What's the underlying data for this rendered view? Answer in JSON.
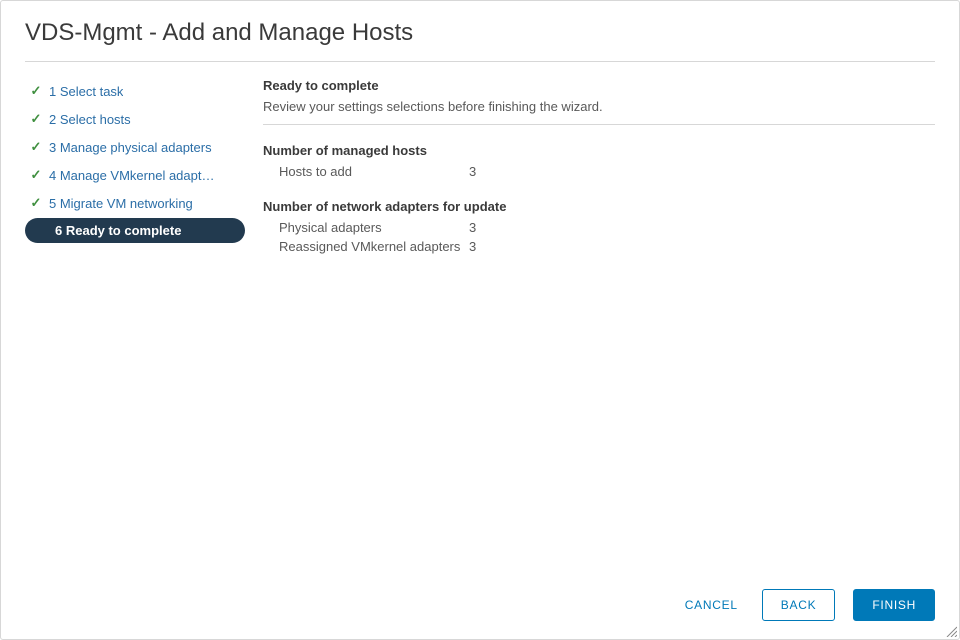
{
  "title": "VDS-Mgmt - Add and Manage Hosts",
  "sidebar": {
    "steps": [
      {
        "label": "1 Select task",
        "done": true,
        "active": false
      },
      {
        "label": "2 Select hosts",
        "done": true,
        "active": false
      },
      {
        "label": "3 Manage physical adapters",
        "done": true,
        "active": false
      },
      {
        "label": "4 Manage VMkernel adapt…",
        "done": true,
        "active": false
      },
      {
        "label": "5 Migrate VM networking",
        "done": true,
        "active": false
      },
      {
        "label": "6 Ready to complete",
        "done": false,
        "active": true
      }
    ]
  },
  "main": {
    "heading": "Ready to complete",
    "subheading": "Review your settings selections before finishing the wizard.",
    "groups": [
      {
        "title": "Number of managed hosts",
        "rows": [
          {
            "k": "Hosts to add",
            "v": "3"
          }
        ]
      },
      {
        "title": "Number of network adapters for update",
        "rows": [
          {
            "k": "Physical adapters",
            "v": "3"
          },
          {
            "k": "Reassigned VMkernel adapters",
            "v": "3"
          }
        ]
      }
    ]
  },
  "footer": {
    "cancel": "CANCEL",
    "back": "BACK",
    "finish": "FINISH"
  }
}
